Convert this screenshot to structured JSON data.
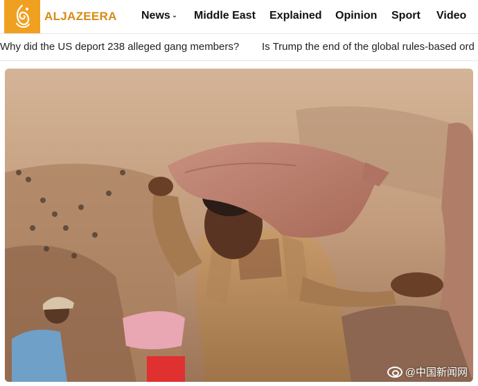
{
  "brand": {
    "name": "ALJAZEERA",
    "accent": "#f0a020",
    "text_color": "#d68a14"
  },
  "nav": {
    "items": [
      {
        "label": "News",
        "has_dropdown": true
      },
      {
        "label": "Middle East"
      },
      {
        "label": "Explained"
      },
      {
        "label": "Opinion"
      },
      {
        "label": "Sport"
      },
      {
        "label": "Video"
      }
    ]
  },
  "trending": [
    "Why did the US deport 238 alleged gang members?",
    "Is Trump the end of the global rules-based ord"
  ],
  "watermark": {
    "text": "@中国新闻网",
    "icon": "weibo-icon"
  }
}
